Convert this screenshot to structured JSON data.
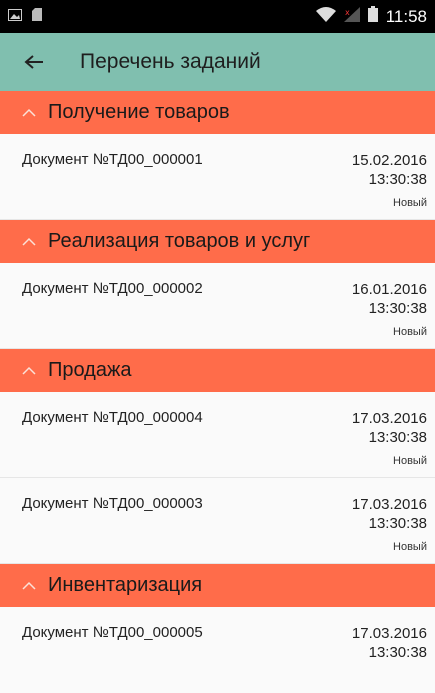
{
  "statusbar": {
    "time": "11:58",
    "icons": [
      "picture-icon",
      "sd-card-icon",
      "wifi-icon",
      "signal-icon",
      "battery-icon"
    ]
  },
  "appbar": {
    "title": "Перечень заданий",
    "back_icon": "arrow-back-icon"
  },
  "colors": {
    "appbar": "#80bfaf",
    "group_header": "#ff6c4a",
    "background": "#fafafa"
  },
  "groups": [
    {
      "title": "Получение товаров",
      "items": [
        {
          "doc": "Документ №ТД00_000001",
          "date": "15.02.2016",
          "time": "13:30:38",
          "status": "Новый"
        }
      ]
    },
    {
      "title": "Реализация товаров и услуг",
      "items": [
        {
          "doc": "Документ №ТД00_000002",
          "date": "16.01.2016",
          "time": "13:30:38",
          "status": "Новый"
        }
      ]
    },
    {
      "title": "Продажа",
      "items": [
        {
          "doc": "Документ №ТД00_000004",
          "date": "17.03.2016",
          "time": "13:30:38",
          "status": "Новый"
        },
        {
          "doc": "Документ №ТД00_000003",
          "date": "17.03.2016",
          "time": "13:30:38",
          "status": "Новый"
        }
      ]
    },
    {
      "title": "Инвентаризация",
      "items": [
        {
          "doc": "Документ №ТД00_000005",
          "date": "17.03.2016",
          "time": "13:30:38",
          "status": ""
        }
      ]
    }
  ]
}
